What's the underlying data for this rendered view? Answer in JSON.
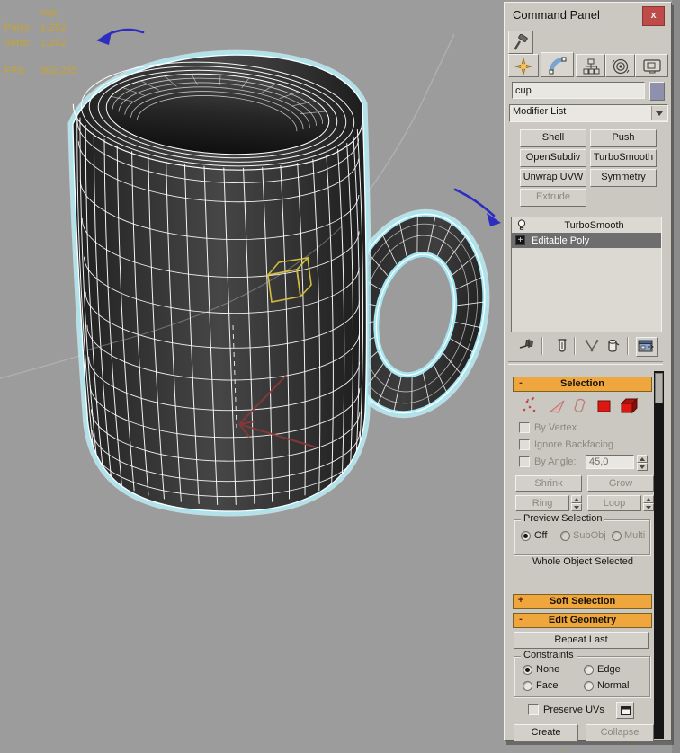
{
  "viewport": {
    "stats": {
      "object_name": "cup",
      "polys_label": "Polys:",
      "polys": "1,252",
      "verts_label": "Verts:",
      "verts": "1,252",
      "fps_label": "FPS:",
      "fps": "302,265"
    },
    "colors": {
      "background": "#9c9c9c",
      "stats_text": "#c9a42d",
      "selection_glow": "#a5e6f1",
      "selection_glow_soft": "#c3eff6",
      "wireframe": "#ffffff",
      "annotation_blue": "#2d2dc0",
      "annotation_red": "#8a3838",
      "gizmo_yellow": "#d8c23e",
      "grid_blue": "#b9c7d2",
      "grid_olive": "#aaa05c"
    }
  },
  "panel": {
    "title": "Command Panel",
    "close_label": "x",
    "tabs": [
      "hammer-icon",
      "create-icon",
      "modify-icon",
      "hierarchy-icon",
      "motion-icon",
      "display-icon"
    ],
    "active_tab": "modify",
    "name_field": {
      "value": "cup"
    },
    "modifier_list_label": "Modifier List",
    "modifier_buttons": [
      {
        "label": "Shell",
        "enabled": true
      },
      {
        "label": "Push",
        "enabled": true
      },
      {
        "label": "OpenSubdiv",
        "enabled": true
      },
      {
        "label": "TurboSmooth",
        "enabled": true
      },
      {
        "label": "Unwrap UVW",
        "enabled": true
      },
      {
        "label": "Symmetry",
        "enabled": true
      },
      {
        "label": "Extrude",
        "enabled": false
      }
    ],
    "modifier_stack": [
      {
        "label": "TurboSmooth",
        "icon": "lightbulb-icon",
        "selected": false
      },
      {
        "label": "Editable Poly",
        "icon": "plus-box-icon",
        "selected": true
      }
    ],
    "stack_tools": [
      "pin-stack-icon",
      "show-end-result-icon",
      "make-unique-icon",
      "remove-modifier-icon",
      "configure-modifier-sets-icon"
    ],
    "selection": {
      "title": "Selection",
      "subobject_icons": [
        "vertex-icon",
        "edge-icon",
        "border-icon",
        "polygon-icon",
        "element-icon"
      ],
      "by_vertex": "By Vertex",
      "ignore_backfacing": "Ignore Backfacing",
      "by_angle": "By Angle:",
      "by_angle_value": "45,0",
      "shrink": "Shrink",
      "grow": "Grow",
      "ring": "Ring",
      "loop": "Loop",
      "preview_title": "Preview Selection",
      "preview_options": [
        "Off",
        "SubObj",
        "Multi"
      ],
      "preview_selected": "Off",
      "status": "Whole Object Selected"
    },
    "soft_selection_title": "Soft Selection",
    "edit_geometry": {
      "title": "Edit Geometry",
      "repeat_last": "Repeat Last",
      "constraints_title": "Constraints",
      "constraints": [
        "None",
        "Edge",
        "Face",
        "Normal"
      ],
      "constraints_selected": "None",
      "preserve_uvs": "Preserve UVs",
      "create": "Create",
      "collapse": "Collapse"
    }
  }
}
